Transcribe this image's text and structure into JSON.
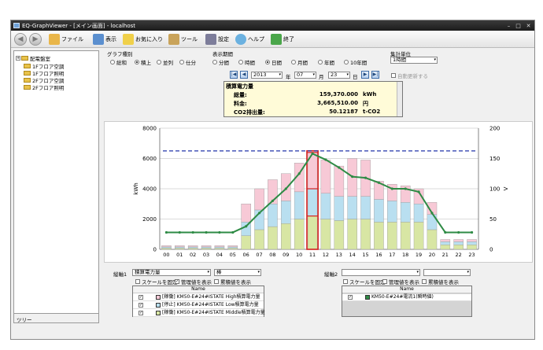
{
  "window": {
    "title": "EQ-GraphViewer - [メイン画面] - localhost"
  },
  "window_controls": {
    "minimize": "–",
    "maximize": "□",
    "close": "✕"
  },
  "toolbar": {
    "back": "◀",
    "forward": "▶",
    "file": "ファイル",
    "view": "表示",
    "favorites": "お気に入り",
    "tools": "ツール",
    "settings": "設定",
    "help": "ヘルプ",
    "exit": "終了"
  },
  "tree": {
    "expander": "+",
    "items": [
      "配電盤室",
      "1Fフロア空調",
      "1Fフロア照明",
      "2Fフロア空調",
      "2Fフロア照明"
    ],
    "footer": "ツリー"
  },
  "graph_type": {
    "label": "グラフ種別",
    "options": [
      "総和",
      "積上",
      "並列",
      "仕分"
    ],
    "selected": "積上"
  },
  "period": {
    "label": "表示期間",
    "options": [
      "分間",
      "時間",
      "日間",
      "月間",
      "年間",
      "10年間"
    ],
    "selected": "日間"
  },
  "unit": {
    "label": "集計単位",
    "value": "1時間"
  },
  "date_nav": {
    "year": "2013",
    "year_suffix": "年",
    "month": "07",
    "month_suffix": "月",
    "day": "23",
    "day_suffix": "日",
    "first": "|◀",
    "prev": "◀",
    "next": "▶",
    "last": "▶|"
  },
  "auto_update": {
    "label": "自動更新する",
    "checked": false
  },
  "summary": {
    "header": "積算電力量",
    "rows": [
      {
        "label": "総量:",
        "value": "159,370.000",
        "unit": "kWh"
      },
      {
        "label": "料金:",
        "value": "3,665,510.00",
        "unit": "円"
      },
      {
        "label": "CO2排出量:",
        "value": "50.12187",
        "unit": "t-CO2"
      }
    ]
  },
  "chart_data": {
    "type": "bar",
    "stacked": true,
    "categories": [
      "00",
      "01",
      "02",
      "03",
      "04",
      "05",
      "06",
      "07",
      "08",
      "09",
      "10",
      "11",
      "12",
      "13",
      "14",
      "15",
      "16",
      "17",
      "18",
      "19",
      "20",
      "21",
      "22",
      "23"
    ],
    "series": [
      {
        "name": "[稼働] KM50-E#24#ISTATE Middle積算電力量",
        "color": "#d8e6a4",
        "values": [
          80,
          80,
          80,
          80,
          80,
          80,
          900,
          1300,
          1500,
          1700,
          2000,
          2200,
          2000,
          1900,
          2000,
          2000,
          1800,
          1800,
          1800,
          1800,
          1300,
          300,
          300,
          300
        ]
      },
      {
        "name": "[停止] KM50-E#24#ISTATE Low積算電力量",
        "color": "#b9dff0",
        "values": [
          80,
          80,
          80,
          80,
          80,
          80,
          900,
          1300,
          1500,
          1500,
          1800,
          1800,
          1700,
          1600,
          1500,
          1500,
          1500,
          1400,
          1300,
          1200,
          1000,
          200,
          200,
          200
        ]
      },
      {
        "name": "[稼働] KM50-E#24#ISTATE High積算電力量",
        "color": "#f7c9d6",
        "values": [
          80,
          80,
          80,
          80,
          80,
          80,
          1200,
          1400,
          1600,
          1800,
          1900,
          2400,
          2200,
          2000,
          2500,
          2400,
          1200,
          1100,
          1100,
          1000,
          800,
          150,
          150,
          150
        ]
      }
    ],
    "line_series": {
      "name": "KM50-E#24#電流1(瞬時値)",
      "color": "#2e8b45",
      "axis": "right",
      "values": [
        28,
        28,
        28,
        28,
        28,
        28,
        38,
        60,
        80,
        100,
        125,
        158,
        148,
        135,
        120,
        118,
        110,
        100,
        100,
        95,
        60,
        28,
        28,
        28
      ]
    },
    "reference_line": {
      "value": 6500,
      "axis": "left",
      "color": "#2233aa"
    },
    "highlight_category": "11",
    "highlight_color": "#d42020",
    "ylabel_left": "kWh",
    "ylabel_right": "V",
    "ylim_left": [
      0,
      8000
    ],
    "ylim_right": [
      0,
      200
    ],
    "yticks_left": [
      "0",
      "2000",
      "4000",
      "6000",
      "8000"
    ],
    "yticks_right": [
      "0",
      "50",
      "100",
      "150",
      "200"
    ],
    "grid": true,
    "legend": "bottom"
  },
  "axis1": {
    "label": "縦軸1",
    "item": "積算電力量",
    "style": "棒",
    "fix_scale": "スケールを固定",
    "show_mgmt": "管理値を表示",
    "show_cum": "累積値を表示",
    "fix_scale_checked": false,
    "show_mgmt_checked": true,
    "show_cum_checked": false
  },
  "axis2": {
    "label": "縦軸2",
    "item": "",
    "style": "",
    "fix_scale": "スケールを固定",
    "show_mgmt": "管理値を表示",
    "show_cum": "累積値を表示"
  },
  "legend1": {
    "header": "Name",
    "rows": [
      {
        "checked": true,
        "color": "#f7c9d6",
        "name": "[稼働] KM50-E#24#ISTATE High積算電力量"
      },
      {
        "checked": true,
        "color": "#b9dff0",
        "name": "[停止] KM50-E#24#ISTATE Low積算電力量"
      },
      {
        "checked": true,
        "color": "#d8e6a4",
        "name": "[稼働] KM50-E#24#ISTATE Middle積算電力量"
      }
    ]
  },
  "legend2": {
    "header": "Name",
    "rows": [
      {
        "checked": true,
        "color": "#2e8b45",
        "name": "KM50-E#24#電流1(瞬時値)"
      }
    ]
  },
  "checkmark": "✓",
  "dropdown_arrow": "▾"
}
